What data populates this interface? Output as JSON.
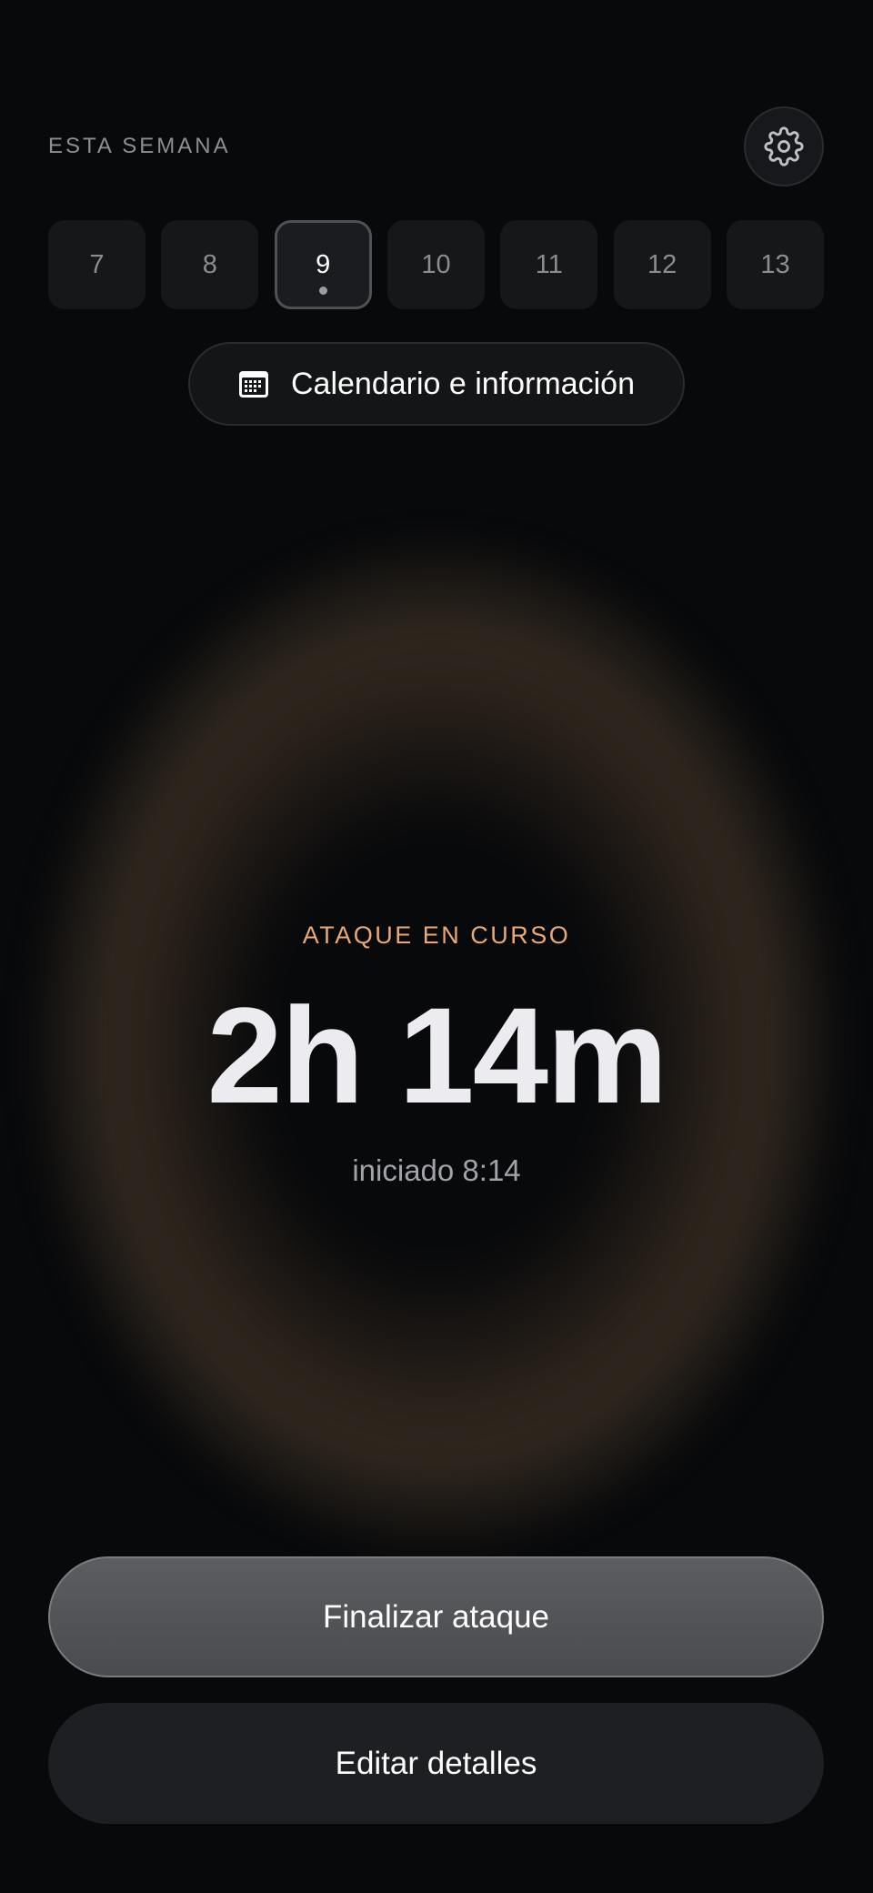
{
  "header": {
    "week_label": "ESTA SEMANA"
  },
  "week": {
    "days": [
      "7",
      "8",
      "9",
      "10",
      "11",
      "12",
      "13"
    ],
    "selected_index": 2
  },
  "calendar_button": {
    "label": "Calendario e información"
  },
  "attack": {
    "status": "ATAQUE EN CURSO",
    "duration": "2h 14m",
    "started": "iniciado 8:14"
  },
  "actions": {
    "end_label": "Finalizar ataque",
    "edit_label": "Editar detalles"
  },
  "colors": {
    "accent": "#e8a977",
    "background": "#08090b"
  }
}
